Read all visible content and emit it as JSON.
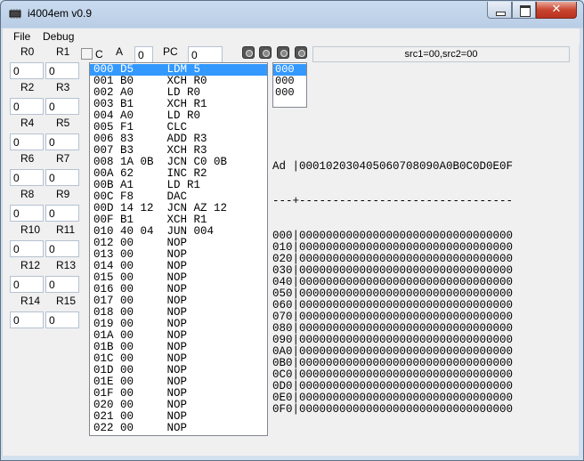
{
  "window": {
    "title": "i4004em v0.9",
    "close_glyph": "✕"
  },
  "menu": {
    "file": "File",
    "debug": "Debug"
  },
  "registers": {
    "pairs": [
      {
        "left_label": "R0",
        "right_label": "R1",
        "left_value": "0",
        "right_value": "0"
      },
      {
        "left_label": "R2",
        "right_label": "R3",
        "left_value": "0",
        "right_value": "0"
      },
      {
        "left_label": "R4",
        "right_label": "R5",
        "left_value": "0",
        "right_value": "0"
      },
      {
        "left_label": "R6",
        "right_label": "R7",
        "left_value": "0",
        "right_value": "0"
      },
      {
        "left_label": "R8",
        "right_label": "R9",
        "left_value": "0",
        "right_value": "0"
      },
      {
        "left_label": "R10",
        "right_label": "R11",
        "left_value": "0",
        "right_value": "0"
      },
      {
        "left_label": "R12",
        "right_label": "R13",
        "left_value": "0",
        "right_value": "0"
      },
      {
        "left_label": "R14",
        "right_label": "R15",
        "left_value": "0",
        "right_value": "0"
      }
    ]
  },
  "carry": {
    "label": "C",
    "checked": false
  },
  "accumulator": {
    "label": "A",
    "value": "0"
  },
  "pc": {
    "label": "PC",
    "value": "0"
  },
  "leds": [
    "led-icon",
    "led-icon",
    "led-icon",
    "led-icon"
  ],
  "status": "src1=00,src2=00",
  "program": [
    "000 D5     LDM 5",
    "001 B0     XCH R0",
    "002 A0     LD R0",
    "003 B1     XCH R1",
    "004 A0     LD R0",
    "005 F1     CLC",
    "006 83     ADD R3",
    "007 B3     XCH R3",
    "008 1A 0B  JCN C0 0B",
    "00A 62     INC R2",
    "00B A1     LD R1",
    "00C F8     DAC",
    "00D 14 12  JCN AZ 12",
    "00F B1     XCH R1",
    "010 40 04  JUN 004",
    "012 00     NOP",
    "013 00     NOP",
    "014 00     NOP",
    "015 00     NOP",
    "016 00     NOP",
    "017 00     NOP",
    "018 00     NOP",
    "019 00     NOP",
    "01A 00     NOP",
    "01B 00     NOP",
    "01C 00     NOP",
    "01D 00     NOP",
    "01E 00     NOP",
    "01F 00     NOP",
    "020 00     NOP",
    "021 00     NOP",
    "022 00     NOP"
  ],
  "stack": [
    "000",
    "000",
    "000"
  ],
  "memory": {
    "header": "Ad |000102030405060708090A0B0C0D0E0F",
    "separator": "---+--------------------------------",
    "rows": [
      "000|00000000000000000000000000000000",
      "010|00000000000000000000000000000000",
      "020|00000000000000000000000000000000",
      "030|00000000000000000000000000000000",
      "040|00000000000000000000000000000000",
      "050|00000000000000000000000000000000",
      "060|00000000000000000000000000000000",
      "070|00000000000000000000000000000000",
      "080|00000000000000000000000000000000",
      "090|00000000000000000000000000000000",
      "0A0|00000000000000000000000000000000",
      "0B0|00000000000000000000000000000000",
      "0C0|00000000000000000000000000000000",
      "0D0|00000000000000000000000000000000",
      "0E0|00000000000000000000000000000000",
      "0F0|00000000000000000000000000000000"
    ]
  }
}
